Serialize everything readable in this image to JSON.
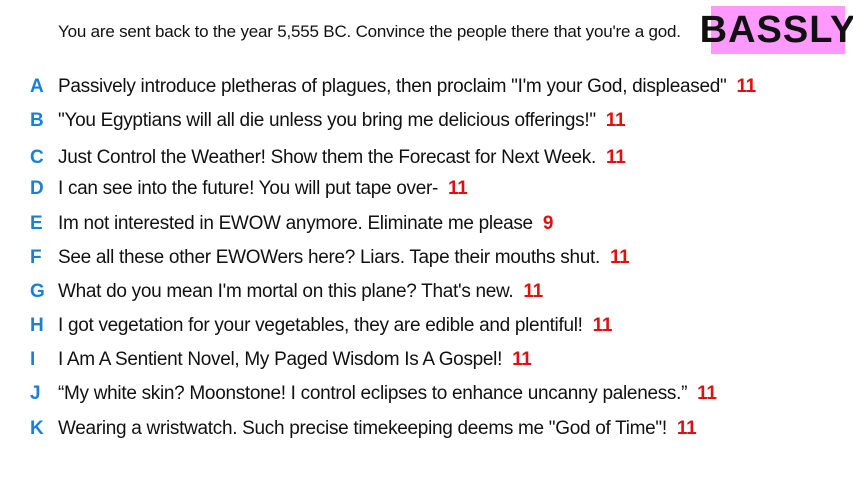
{
  "prompt": "You are sent back to the year 5,555 BC. Convince the people there that you're a god.",
  "badge": "BASSLY",
  "colors": {
    "letter": "#1a7fd6",
    "score": "#e01010",
    "badge_bg": "#ff99ff"
  },
  "responses": [
    {
      "letter": "A",
      "text": "Passively introduce pletheras of plagues, then proclaim \"I'm your God, displeased\"",
      "score": "11"
    },
    {
      "letter": "B",
      "text": "\"You Egyptians will all die unless you bring me delicious offerings!\"",
      "score": "11"
    },
    {
      "letter": "C",
      "text": "Just Control the Weather! Show them the Forecast for Next Week.",
      "score": "11"
    },
    {
      "letter": "D",
      "text": "I can see into the future! You will put tape over-",
      "score": "11"
    },
    {
      "letter": "E",
      "text": "Im not interested in EWOW anymore. Eliminate me please",
      "score": "9"
    },
    {
      "letter": "F",
      "text": "See all these other EWOWers here? Liars. Tape their mouths shut.",
      "score": "11"
    },
    {
      "letter": "G",
      "text": "What do you mean I'm mortal on this plane? That's new.",
      "score": "11"
    },
    {
      "letter": "H",
      "text": "I got vegetation for your vegetables, they are edible and plentiful!",
      "score": "11"
    },
    {
      "letter": "I",
      "text": "I Am A Sentient Novel, My Paged Wisdom Is A Gospel!",
      "score": "11"
    },
    {
      "letter": "J",
      "text": "“My white skin? Moonstone! I control eclipses to enhance uncanny paleness.”",
      "score": "11"
    },
    {
      "letter": "K",
      "text": "Wearing a wristwatch. Such precise timekeeping deems me \"God of Time\"!",
      "score": "11"
    }
  ]
}
